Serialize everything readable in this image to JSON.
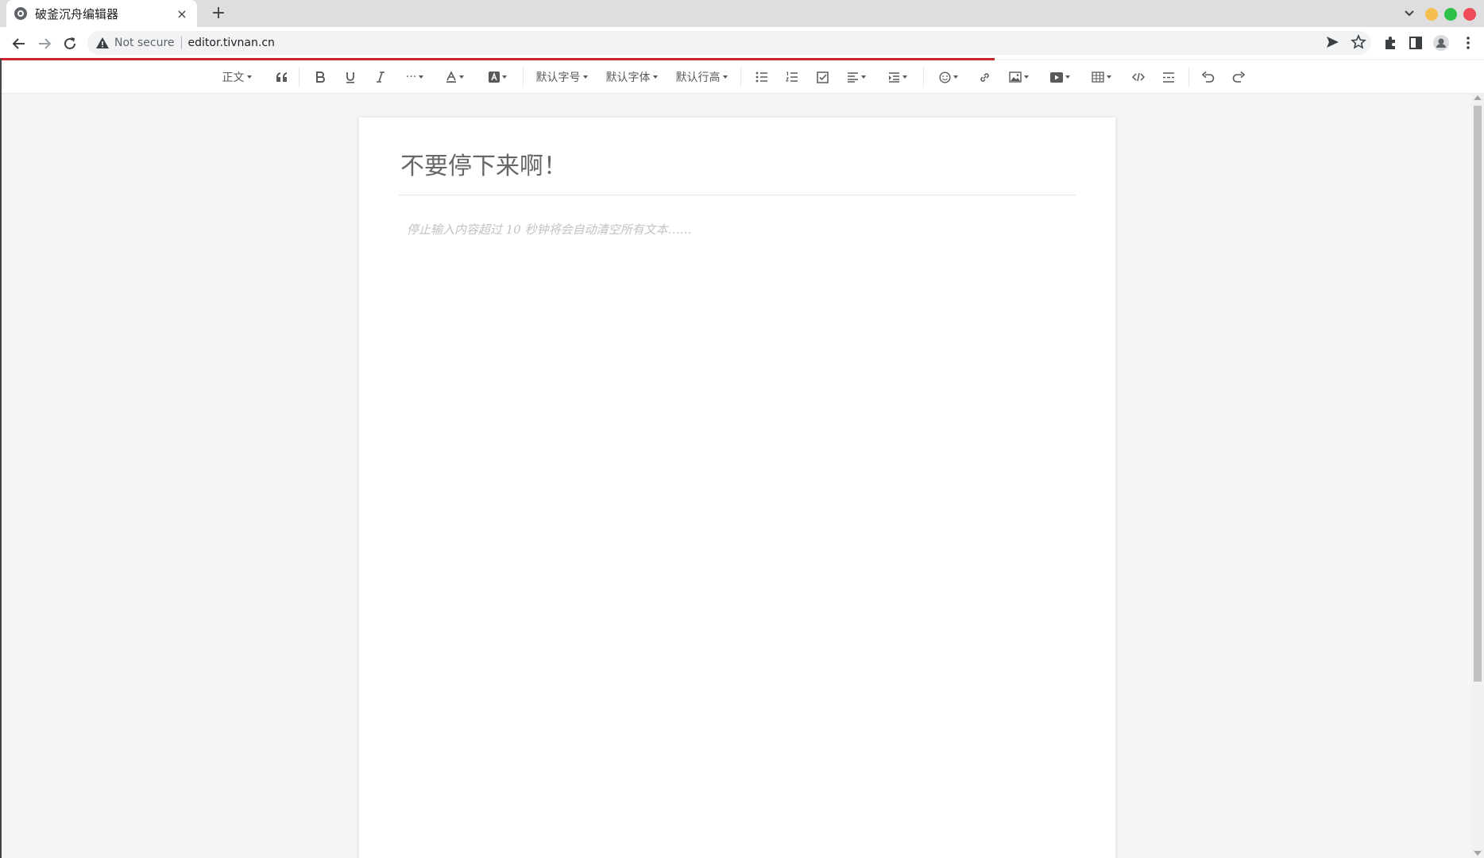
{
  "browser": {
    "tab_title": "破釜沉舟编辑器",
    "tab_close": "×",
    "new_tab": "+",
    "security_label": "Not secure",
    "url": "editor.tivnan.cn",
    "window_colors": {
      "minimize": "#f6be4f",
      "maximize": "#2ec14a",
      "close": "#ed4b59"
    },
    "progress_color": "#c8262e",
    "load_progress": 0.67
  },
  "toolbar": {
    "heading_select": "正文",
    "font_size_select": "默认字号",
    "font_family_select": "默认字体",
    "line_height_select": "默认行高",
    "more_label": "···"
  },
  "document": {
    "title": "不要停下来啊！",
    "placeholder": "停止输入内容超过 10 秒钟将会自动清空所有文本……"
  }
}
